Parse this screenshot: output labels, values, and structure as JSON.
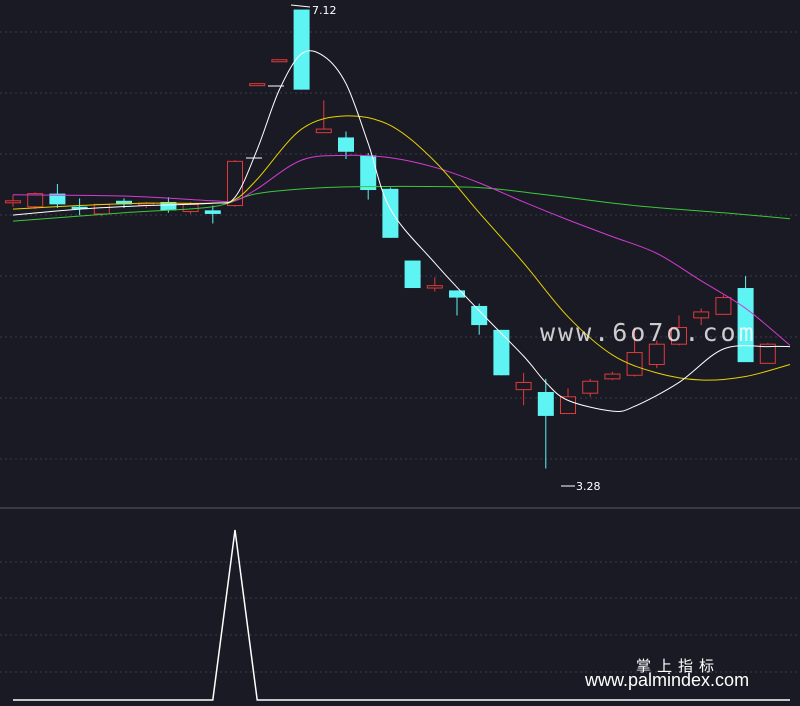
{
  "colors": {
    "background": "#1a1a24",
    "grid": "#3c3c4c",
    "up": "#e03a3a",
    "down": "#5ff4f4",
    "ma_white": "#ffffff",
    "ma_yellow": "#e6d200",
    "ma_magenta": "#d23cd2",
    "ma_green": "#3cc83c",
    "indicator": "#ffffff"
  },
  "watermarks": {
    "main": "www.6o7o.com",
    "brand_cn": "掌上指标",
    "brand_url": "www.palmindex.com"
  },
  "labels": {
    "high": "7.12",
    "low": "3.28"
  },
  "chart_data": {
    "type": "candlestick",
    "ylim": [
      3.1,
      7.2
    ],
    "candles": [
      {
        "o": 5.52,
        "h": 5.57,
        "l": 5.47,
        "c": 5.52
      },
      {
        "o": 5.47,
        "h": 5.59,
        "l": 5.45,
        "c": 5.58
      },
      {
        "o": 5.58,
        "h": 5.66,
        "l": 5.46,
        "c": 5.49
      },
      {
        "o": 5.47,
        "h": 5.54,
        "l": 5.4,
        "c": 5.45
      },
      {
        "o": 5.41,
        "h": 5.49,
        "l": 5.39,
        "c": 5.49
      },
      {
        "o": 5.52,
        "h": 5.54,
        "l": 5.46,
        "c": 5.49
      },
      {
        "o": 5.49,
        "h": 5.51,
        "l": 5.46,
        "c": 5.5
      },
      {
        "o": 5.51,
        "h": 5.55,
        "l": 5.42,
        "c": 5.44
      },
      {
        "o": 5.43,
        "h": 5.51,
        "l": 5.41,
        "c": 5.49
      },
      {
        "o": 5.44,
        "h": 5.48,
        "l": 5.33,
        "c": 5.41
      },
      {
        "o": 5.48,
        "h": 5.86,
        "l": 5.47,
        "c": 5.85
      },
      {
        "o": 6.5,
        "h": 6.5,
        "l": 6.5,
        "c": 6.5
      },
      {
        "o": 6.7,
        "h": 6.7,
        "l": 6.7,
        "c": 6.7
      },
      {
        "o": 7.12,
        "h": 7.12,
        "l": 6.45,
        "c": 6.45
      },
      {
        "o": 6.09,
        "h": 6.36,
        "l": 6.09,
        "c": 6.12
      },
      {
        "o": 6.05,
        "h": 6.1,
        "l": 5.87,
        "c": 5.93
      },
      {
        "o": 5.9,
        "h": 5.92,
        "l": 5.53,
        "c": 5.61
      },
      {
        "o": 5.62,
        "h": 5.63,
        "l": 5.21,
        "c": 5.21
      },
      {
        "o": 5.02,
        "h": 5.02,
        "l": 4.79,
        "c": 4.79
      },
      {
        "o": 4.79,
        "h": 4.88,
        "l": 4.76,
        "c": 4.81
      },
      {
        "o": 4.77,
        "h": 4.77,
        "l": 4.56,
        "c": 4.71
      },
      {
        "o": 4.64,
        "h": 4.66,
        "l": 4.4,
        "c": 4.48
      },
      {
        "o": 4.44,
        "h": 4.44,
        "l": 4.06,
        "c": 4.06
      },
      {
        "o": 3.94,
        "h": 4.08,
        "l": 3.81,
        "c": 4.0
      },
      {
        "o": 3.92,
        "h": 4.03,
        "l": 3.28,
        "c": 3.72
      },
      {
        "o": 3.74,
        "h": 3.95,
        "l": 3.77,
        "c": 3.88
      },
      {
        "o": 3.91,
        "h": 4.03,
        "l": 3.88,
        "c": 4.01
      },
      {
        "o": 4.03,
        "h": 4.09,
        "l": 4.02,
        "c": 4.07
      },
      {
        "o": 4.06,
        "h": 4.46,
        "l": 4.05,
        "c": 4.25
      },
      {
        "o": 4.15,
        "h": 4.35,
        "l": 4.12,
        "c": 4.32
      },
      {
        "o": 4.32,
        "h": 4.56,
        "l": 4.31,
        "c": 4.46
      },
      {
        "o": 4.54,
        "h": 4.62,
        "l": 4.48,
        "c": 4.59
      },
      {
        "o": 4.57,
        "h": 4.73,
        "l": 4.58,
        "c": 4.71
      },
      {
        "o": 4.79,
        "h": 4.89,
        "l": 4.76,
        "c": 4.17
      },
      {
        "o": 4.16,
        "h": 4.33,
        "l": 4.16,
        "c": 4.32
      }
    ],
    "ma_white": [
      [
        0,
        5.4
      ],
      [
        3,
        5.45
      ],
      [
        6,
        5.48
      ],
      [
        9,
        5.5
      ],
      [
        10,
        5.55
      ],
      [
        11,
        5.95
      ],
      [
        12,
        6.45
      ],
      [
        13,
        6.75
      ],
      [
        14,
        6.73
      ],
      [
        15,
        6.5
      ],
      [
        16,
        6.0
      ],
      [
        17,
        5.45
      ],
      [
        19,
        5.0
      ],
      [
        21,
        4.6
      ],
      [
        23,
        4.22
      ],
      [
        24,
        4.0
      ],
      [
        25,
        3.85
      ],
      [
        27,
        3.76
      ],
      [
        28,
        3.8
      ],
      [
        30,
        4.0
      ],
      [
        32,
        4.28
      ],
      [
        34,
        4.3
      ],
      [
        35,
        4.3
      ]
    ],
    "ma_yellow": [
      [
        0,
        5.45
      ],
      [
        3,
        5.48
      ],
      [
        6,
        5.5
      ],
      [
        9,
        5.5
      ],
      [
        10,
        5.53
      ],
      [
        11,
        5.7
      ],
      [
        13,
        6.12
      ],
      [
        15,
        6.23
      ],
      [
        17,
        6.15
      ],
      [
        19,
        5.85
      ],
      [
        21,
        5.42
      ],
      [
        23,
        5.0
      ],
      [
        25,
        4.55
      ],
      [
        27,
        4.23
      ],
      [
        29,
        4.08
      ],
      [
        31,
        4.02
      ],
      [
        33,
        4.05
      ],
      [
        35,
        4.15
      ]
    ],
    "ma_magenta": [
      [
        0,
        5.57
      ],
      [
        5,
        5.56
      ],
      [
        9,
        5.52
      ],
      [
        10,
        5.52
      ],
      [
        11,
        5.62
      ],
      [
        13,
        5.86
      ],
      [
        15,
        5.9
      ],
      [
        17,
        5.88
      ],
      [
        19,
        5.8
      ],
      [
        21,
        5.67
      ],
      [
        23,
        5.51
      ],
      [
        25,
        5.36
      ],
      [
        27,
        5.22
      ],
      [
        29,
        5.08
      ],
      [
        31,
        4.85
      ],
      [
        33,
        4.62
      ],
      [
        35,
        4.31
      ]
    ],
    "ma_green": [
      [
        0,
        5.35
      ],
      [
        5,
        5.42
      ],
      [
        9,
        5.47
      ],
      [
        11,
        5.58
      ],
      [
        14,
        5.63
      ],
      [
        17,
        5.64
      ],
      [
        21,
        5.63
      ],
      [
        24,
        5.57
      ],
      [
        28,
        5.48
      ],
      [
        32,
        5.42
      ],
      [
        35,
        5.37
      ]
    ],
    "indicator": [
      [
        0,
        0
      ],
      [
        9,
        0
      ],
      [
        10,
        1
      ],
      [
        11,
        0
      ],
      [
        35,
        0
      ]
    ],
    "indicator_ylim": [
      0,
      1
    ]
  }
}
